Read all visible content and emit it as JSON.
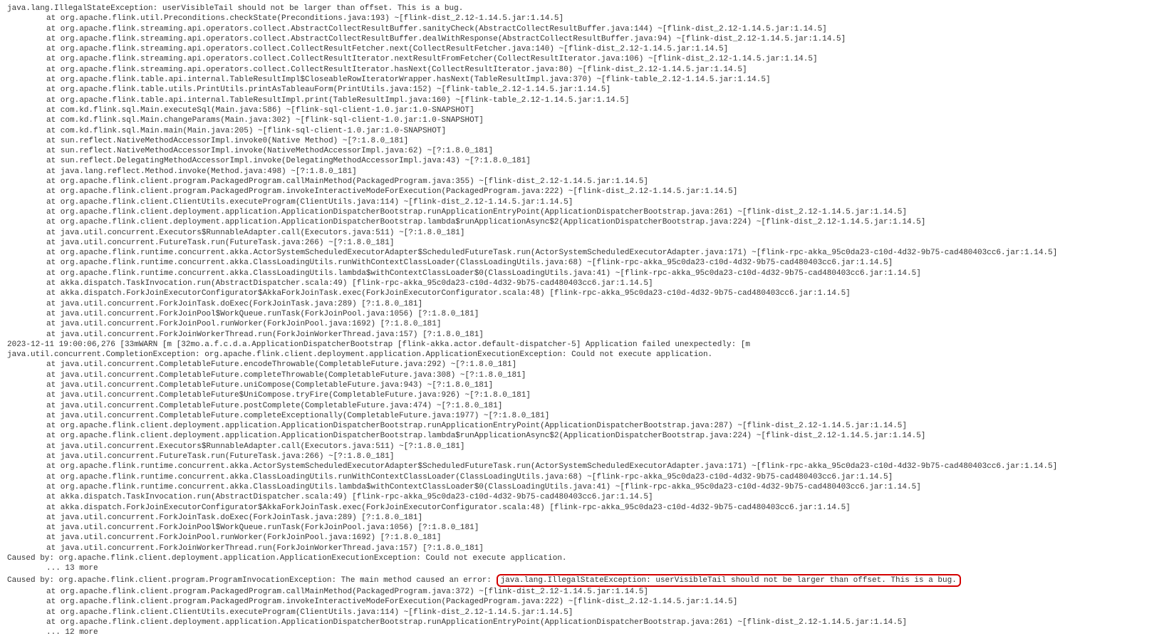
{
  "stack1_header": "java.lang.IllegalStateException: userVisibleTail should not be larger than offset. This is a bug.",
  "stack1": [
    "at org.apache.flink.util.Preconditions.checkState(Preconditions.java:193) ~[flink-dist_2.12-1.14.5.jar:1.14.5]",
    "at org.apache.flink.streaming.api.operators.collect.AbstractCollectResultBuffer.sanityCheck(AbstractCollectResultBuffer.java:144) ~[flink-dist_2.12-1.14.5.jar:1.14.5]",
    "at org.apache.flink.streaming.api.operators.collect.AbstractCollectResultBuffer.dealWithResponse(AbstractCollectResultBuffer.java:94) ~[flink-dist_2.12-1.14.5.jar:1.14.5]",
    "at org.apache.flink.streaming.api.operators.collect.CollectResultFetcher.next(CollectResultFetcher.java:140) ~[flink-dist_2.12-1.14.5.jar:1.14.5]",
    "at org.apache.flink.streaming.api.operators.collect.CollectResultIterator.nextResultFromFetcher(CollectResultIterator.java:106) ~[flink-dist_2.12-1.14.5.jar:1.14.5]",
    "at org.apache.flink.streaming.api.operators.collect.CollectResultIterator.hasNext(CollectResultIterator.java:80) ~[flink-dist_2.12-1.14.5.jar:1.14.5]",
    "at org.apache.flink.table.api.internal.TableResultImpl$CloseableRowIteratorWrapper.hasNext(TableResultImpl.java:370) ~[flink-table_2.12-1.14.5.jar:1.14.5]",
    "at org.apache.flink.table.utils.PrintUtils.printAsTableauForm(PrintUtils.java:152) ~[flink-table_2.12-1.14.5.jar:1.14.5]",
    "at org.apache.flink.table.api.internal.TableResultImpl.print(TableResultImpl.java:160) ~[flink-table_2.12-1.14.5.jar:1.14.5]",
    "at com.kd.flink.sql.Main.executeSql(Main.java:586) ~[flink-sql-client-1.0.jar:1.0-SNAPSHOT]",
    "at com.kd.flink.sql.Main.changeParams(Main.java:302) ~[flink-sql-client-1.0.jar:1.0-SNAPSHOT]",
    "at com.kd.flink.sql.Main.main(Main.java:205) ~[flink-sql-client-1.0.jar:1.0-SNAPSHOT]",
    "at sun.reflect.NativeMethodAccessorImpl.invoke0(Native Method) ~[?:1.8.0_181]",
    "at sun.reflect.NativeMethodAccessorImpl.invoke(NativeMethodAccessorImpl.java:62) ~[?:1.8.0_181]",
    "at sun.reflect.DelegatingMethodAccessorImpl.invoke(DelegatingMethodAccessorImpl.java:43) ~[?:1.8.0_181]",
    "at java.lang.reflect.Method.invoke(Method.java:498) ~[?:1.8.0_181]",
    "at org.apache.flink.client.program.PackagedProgram.callMainMethod(PackagedProgram.java:355) ~[flink-dist_2.12-1.14.5.jar:1.14.5]",
    "at org.apache.flink.client.program.PackagedProgram.invokeInteractiveModeForExecution(PackagedProgram.java:222) ~[flink-dist_2.12-1.14.5.jar:1.14.5]",
    "at org.apache.flink.client.ClientUtils.executeProgram(ClientUtils.java:114) ~[flink-dist_2.12-1.14.5.jar:1.14.5]",
    "at org.apache.flink.client.deployment.application.ApplicationDispatcherBootstrap.runApplicationEntryPoint(ApplicationDispatcherBootstrap.java:261) ~[flink-dist_2.12-1.14.5.jar:1.14.5]",
    "at org.apache.flink.client.deployment.application.ApplicationDispatcherBootstrap.lambda$runApplicationAsync$2(ApplicationDispatcherBootstrap.java:224) ~[flink-dist_2.12-1.14.5.jar:1.14.5]",
    "at java.util.concurrent.Executors$RunnableAdapter.call(Executors.java:511) ~[?:1.8.0_181]",
    "at java.util.concurrent.FutureTask.run(FutureTask.java:266) ~[?:1.8.0_181]",
    "at org.apache.flink.runtime.concurrent.akka.ActorSystemScheduledExecutorAdapter$ScheduledFutureTask.run(ActorSystemScheduledExecutorAdapter.java:171) ~[flink-rpc-akka_95c0da23-c10d-4d32-9b75-cad480403cc6.jar:1.14.5]",
    "at org.apache.flink.runtime.concurrent.akka.ClassLoadingUtils.runWithContextClassLoader(ClassLoadingUtils.java:68) ~[flink-rpc-akka_95c0da23-c10d-4d32-9b75-cad480403cc6.jar:1.14.5]",
    "at org.apache.flink.runtime.concurrent.akka.ClassLoadingUtils.lambda$withContextClassLoader$0(ClassLoadingUtils.java:41) ~[flink-rpc-akka_95c0da23-c10d-4d32-9b75-cad480403cc6.jar:1.14.5]",
    "at akka.dispatch.TaskInvocation.run(AbstractDispatcher.scala:49) [flink-rpc-akka_95c0da23-c10d-4d32-9b75-cad480403cc6.jar:1.14.5]",
    "at akka.dispatch.ForkJoinExecutorConfigurator$AkkaForkJoinTask.exec(ForkJoinExecutorConfigurator.scala:48) [flink-rpc-akka_95c0da23-c10d-4d32-9b75-cad480403cc6.jar:1.14.5]",
    "at java.util.concurrent.ForkJoinTask.doExec(ForkJoinTask.java:289) [?:1.8.0_181]",
    "at java.util.concurrent.ForkJoinPool$WorkQueue.runTask(ForkJoinPool.java:1056) [?:1.8.0_181]",
    "at java.util.concurrent.ForkJoinPool.runWorker(ForkJoinPool.java:1692) [?:1.8.0_181]",
    "at java.util.concurrent.ForkJoinWorkerThread.run(ForkJoinWorkerThread.java:157) [?:1.8.0_181]"
  ],
  "warn_line": "2023-12-11 19:00:06,276 [33mWARN [m [32mo.a.f.c.d.a.ApplicationDispatcherBootstrap [flink-akka.actor.default-dispatcher-5] Application failed unexpectedly: [m",
  "stack2_header": "java.util.concurrent.CompletionException: org.apache.flink.client.deployment.application.ApplicationExecutionException: Could not execute application.",
  "stack2": [
    "at java.util.concurrent.CompletableFuture.encodeThrowable(CompletableFuture.java:292) ~[?:1.8.0_181]",
    "at java.util.concurrent.CompletableFuture.completeThrowable(CompletableFuture.java:308) ~[?:1.8.0_181]",
    "at java.util.concurrent.CompletableFuture.uniCompose(CompletableFuture.java:943) ~[?:1.8.0_181]",
    "at java.util.concurrent.CompletableFuture$UniCompose.tryFire(CompletableFuture.java:926) ~[?:1.8.0_181]",
    "at java.util.concurrent.CompletableFuture.postComplete(CompletableFuture.java:474) ~[?:1.8.0_181]",
    "at java.util.concurrent.CompletableFuture.completeExceptionally(CompletableFuture.java:1977) ~[?:1.8.0_181]",
    "at org.apache.flink.client.deployment.application.ApplicationDispatcherBootstrap.runApplicationEntryPoint(ApplicationDispatcherBootstrap.java:287) ~[flink-dist_2.12-1.14.5.jar:1.14.5]",
    "at org.apache.flink.client.deployment.application.ApplicationDispatcherBootstrap.lambda$runApplicationAsync$2(ApplicationDispatcherBootstrap.java:224) ~[flink-dist_2.12-1.14.5.jar:1.14.5]",
    "at java.util.concurrent.Executors$RunnableAdapter.call(Executors.java:511) ~[?:1.8.0_181]",
    "at java.util.concurrent.FutureTask.run(FutureTask.java:266) ~[?:1.8.0_181]",
    "at org.apache.flink.runtime.concurrent.akka.ActorSystemScheduledExecutorAdapter$ScheduledFutureTask.run(ActorSystemScheduledExecutorAdapter.java:171) ~[flink-rpc-akka_95c0da23-c10d-4d32-9b75-cad480403cc6.jar:1.14.5]",
    "at org.apache.flink.runtime.concurrent.akka.ClassLoadingUtils.runWithContextClassLoader(ClassLoadingUtils.java:68) ~[flink-rpc-akka_95c0da23-c10d-4d32-9b75-cad480403cc6.jar:1.14.5]",
    "at org.apache.flink.runtime.concurrent.akka.ClassLoadingUtils.lambda$withContextClassLoader$0(ClassLoadingUtils.java:41) ~[flink-rpc-akka_95c0da23-c10d-4d32-9b75-cad480403cc6.jar:1.14.5]",
    "at akka.dispatch.TaskInvocation.run(AbstractDispatcher.scala:49) [flink-rpc-akka_95c0da23-c10d-4d32-9b75-cad480403cc6.jar:1.14.5]",
    "at akka.dispatch.ForkJoinExecutorConfigurator$AkkaForkJoinTask.exec(ForkJoinExecutorConfigurator.scala:48) [flink-rpc-akka_95c0da23-c10d-4d32-9b75-cad480403cc6.jar:1.14.5]",
    "at java.util.concurrent.ForkJoinTask.doExec(ForkJoinTask.java:289) [?:1.8.0_181]",
    "at java.util.concurrent.ForkJoinPool$WorkQueue.runTask(ForkJoinPool.java:1056) [?:1.8.0_181]",
    "at java.util.concurrent.ForkJoinPool.runWorker(ForkJoinPool.java:1692) [?:1.8.0_181]",
    "at java.util.concurrent.ForkJoinWorkerThread.run(ForkJoinWorkerThread.java:157) [?:1.8.0_181]"
  ],
  "caused_by_1": "Caused by: org.apache.flink.client.deployment.application.ApplicationExecutionException: Could not execute application.",
  "more_1": "... 13 more",
  "caused_by_2_pre": "Caused by: org.apache.flink.client.program.ProgramInvocationException: The main method caused an error: ",
  "caused_by_2_highlight": "java.lang.IllegalStateException: userVisibleTail should not be larger than offset. This is a bug.",
  "stack3": [
    "at org.apache.flink.client.program.PackagedProgram.callMainMethod(PackagedProgram.java:372) ~[flink-dist_2.12-1.14.5.jar:1.14.5]",
    "at org.apache.flink.client.program.PackagedProgram.invokeInteractiveModeForExecution(PackagedProgram.java:222) ~[flink-dist_2.12-1.14.5.jar:1.14.5]",
    "at org.apache.flink.client.ClientUtils.executeProgram(ClientUtils.java:114) ~[flink-dist_2.12-1.14.5.jar:1.14.5]",
    "at org.apache.flink.client.deployment.application.ApplicationDispatcherBootstrap.runApplicationEntryPoint(ApplicationDispatcherBootstrap.java:261) ~[flink-dist_2.12-1.14.5.jar:1.14.5]"
  ],
  "more_2": "... 12 more"
}
